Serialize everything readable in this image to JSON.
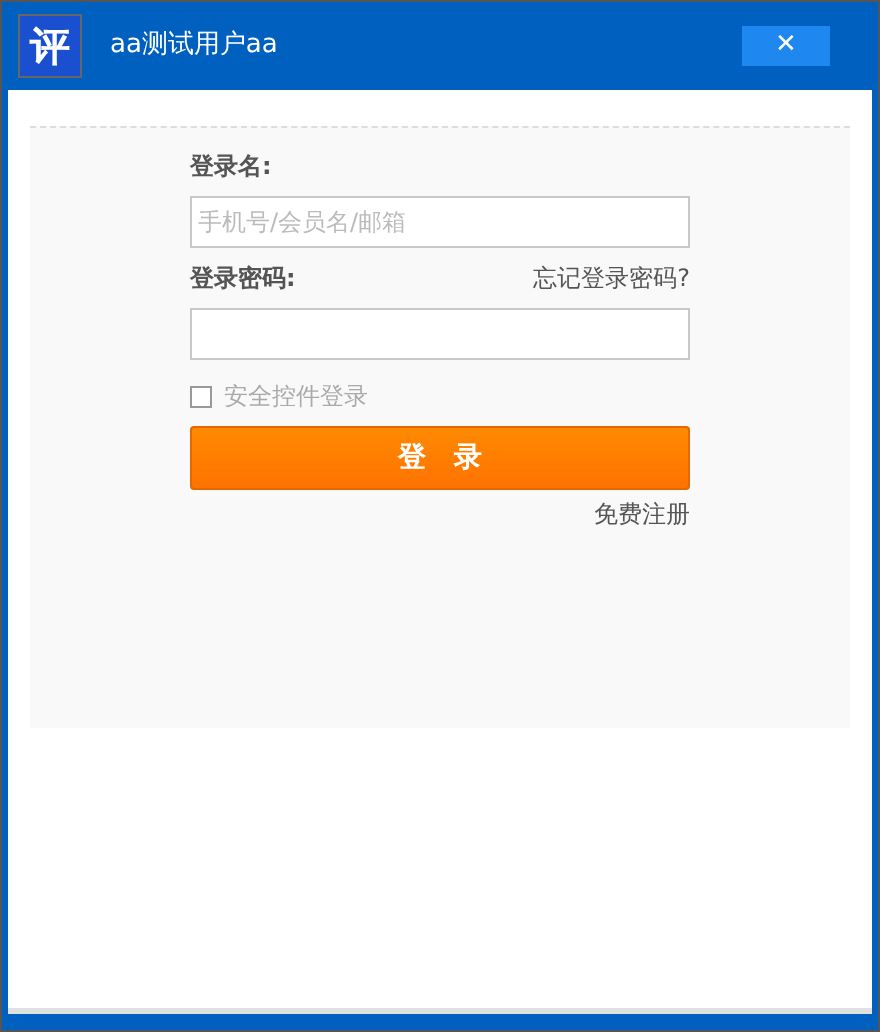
{
  "window": {
    "logo": "评",
    "title": "aa测试用户aa",
    "close": "✕"
  },
  "login": {
    "username_label": "登录名:",
    "username_placeholder": "手机号/会员名/邮箱",
    "password_label": "登录密码:",
    "forgot_link": "忘记登录密码?",
    "secure_control": {
      "label": "安全控件登录",
      "checked": false
    },
    "submit": "登　录",
    "register_link": "免费注册"
  }
}
